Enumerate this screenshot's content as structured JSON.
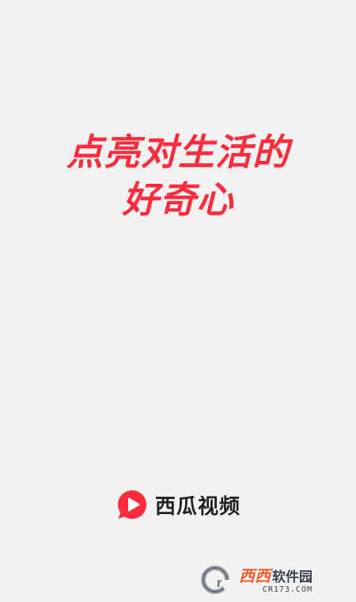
{
  "splash": {
    "slogan_line1": "点亮对生活的",
    "slogan_line2": "好奇心"
  },
  "brand": {
    "name": "西瓜视频",
    "logo_icon": "xigua-logo-icon",
    "accent_color": "#fe2c3c"
  },
  "watermark": {
    "badge_icon": "cr-badge-icon",
    "xixi": "西西",
    "label": "软件园",
    "site": "CR173.COM"
  }
}
